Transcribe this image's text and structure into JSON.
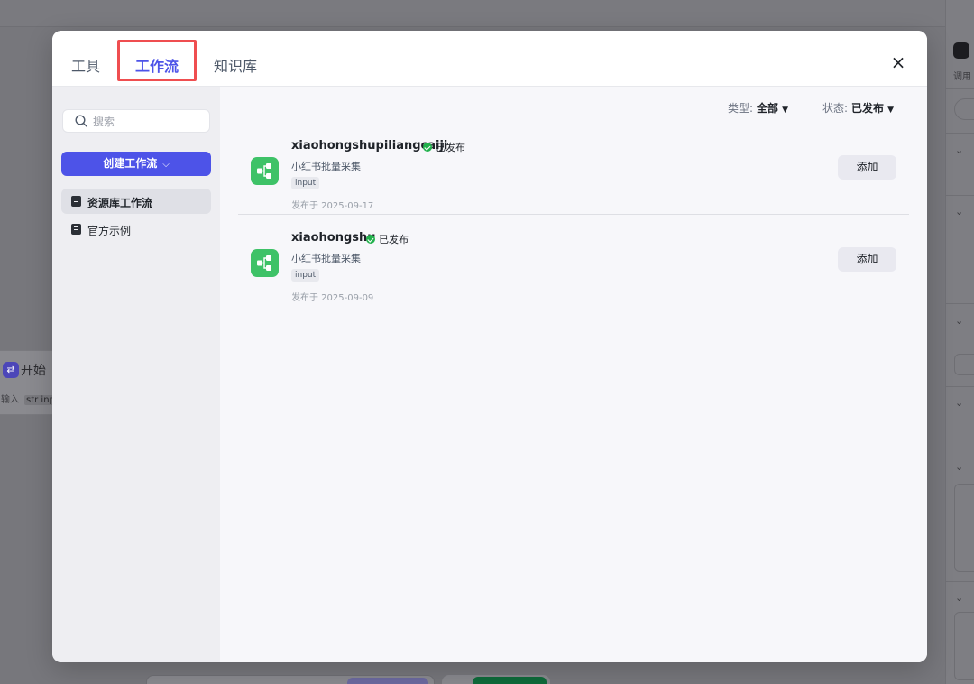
{
  "background": {
    "start_node": {
      "title": "开始",
      "sub_prefix": "输入",
      "sub_var": "str input"
    }
  },
  "modal": {
    "tabs": [
      {
        "label": "工具"
      },
      {
        "label": "工作流"
      },
      {
        "label": "知识库"
      }
    ],
    "active_tab": "工作流",
    "close_icon": "×",
    "sidebar": {
      "search_placeholder": "搜索",
      "create_button": "创建工作流",
      "items": [
        {
          "label": "资源库工作流",
          "active": true
        },
        {
          "label": "官方示例",
          "active": false
        }
      ]
    },
    "filters": {
      "type_label": "类型:",
      "type_value": "全部",
      "status_label": "状态:",
      "status_value": "已发布"
    },
    "workflows": [
      {
        "name": "xiaohongshupiliangcaiji",
        "status": "已发布",
        "description": "小红书批量采集",
        "tag": "input",
        "published": "发布于 2025-09-17",
        "action": "添加"
      },
      {
        "name": "xiaohongshu",
        "status": "已发布",
        "description": "小红书批量采集",
        "tag": "input",
        "published": "发布于 2025-09-09",
        "action": "添加"
      }
    ]
  },
  "colors": {
    "accent": "#4d53e8",
    "highlight_border": "#ef4e50",
    "workflow_icon": "#3ec267",
    "published_dot": "#22b14c"
  }
}
